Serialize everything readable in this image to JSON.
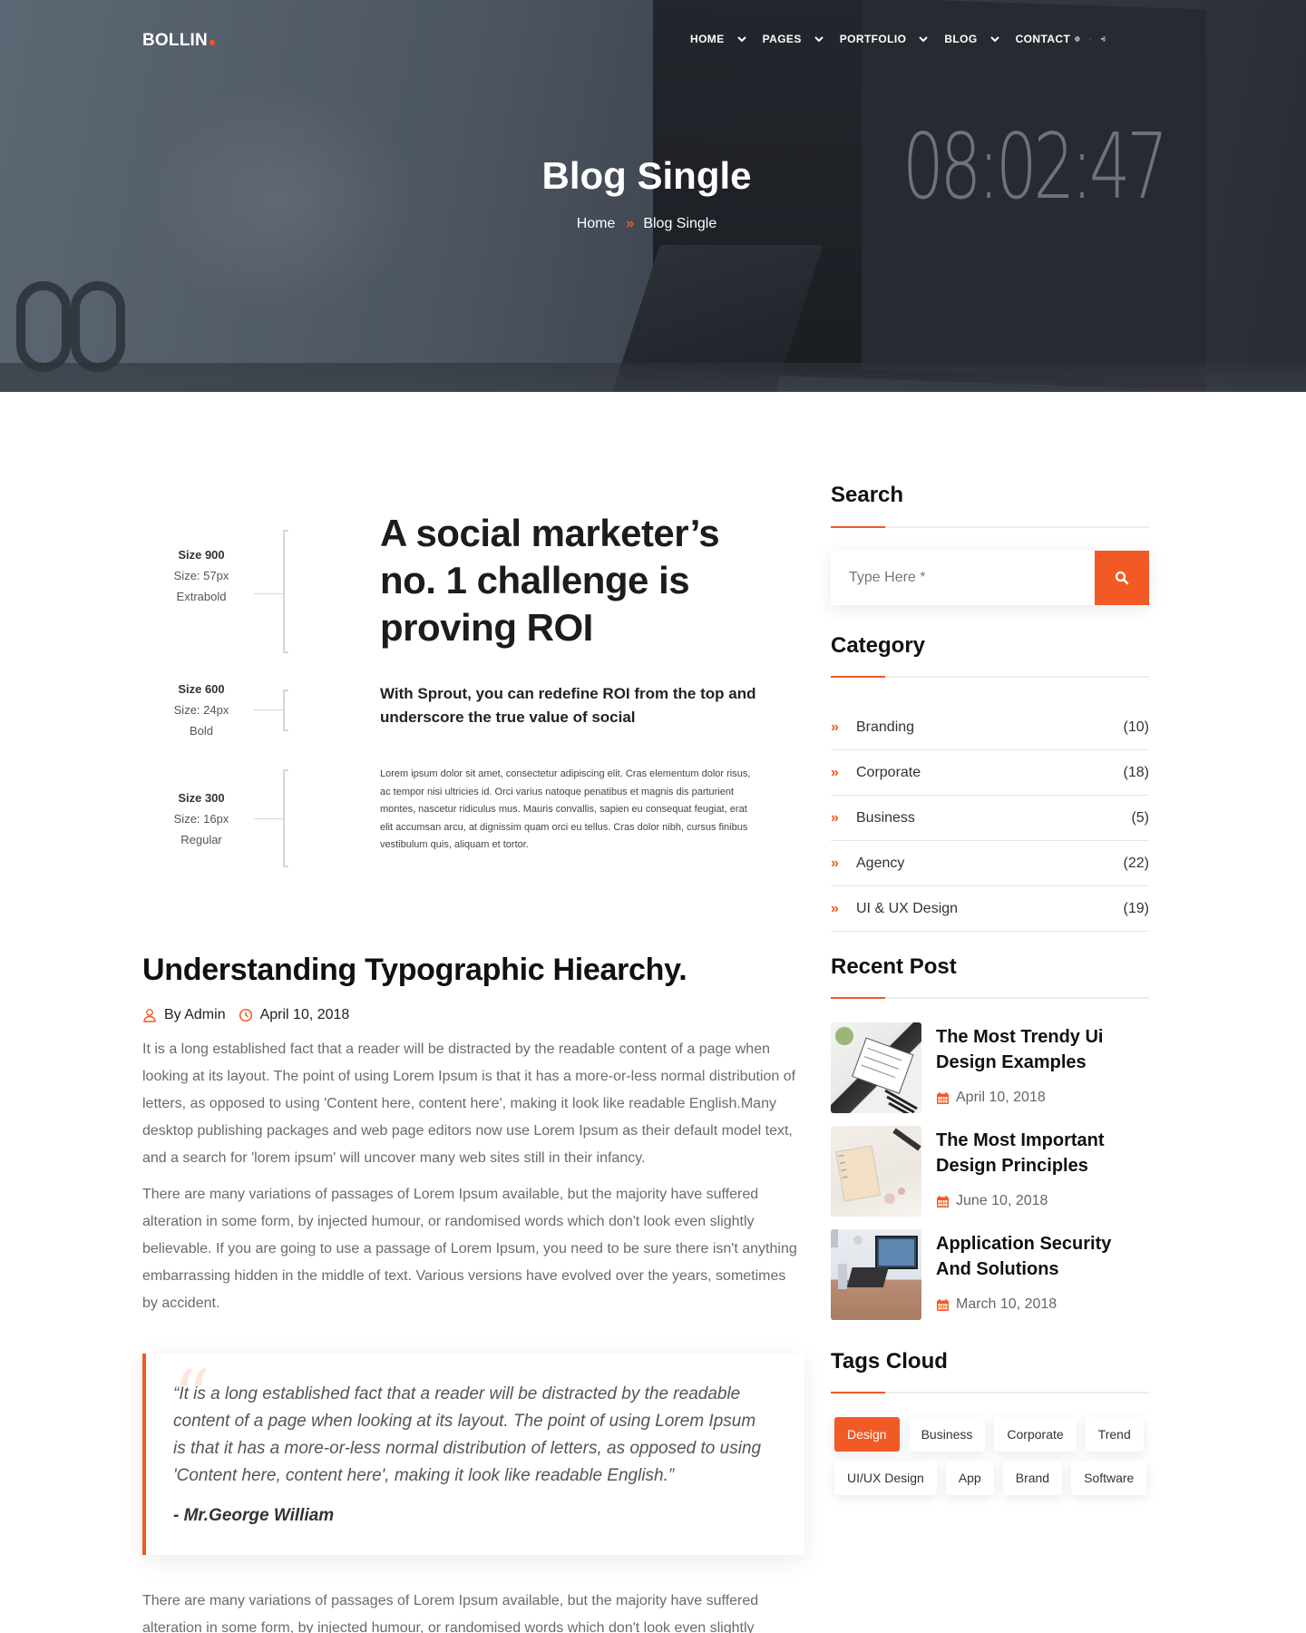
{
  "nav": {
    "logo": "BOLLIN",
    "items": [
      {
        "label": "HOME"
      },
      {
        "label": "PAGES"
      },
      {
        "label": "PORTFOLIO"
      },
      {
        "label": "BLOG"
      },
      {
        "label": "CONTACT"
      }
    ]
  },
  "hero": {
    "title": "Blog Single",
    "clock": "08:02:47",
    "breadcrumb": {
      "home": "Home",
      "current": "Blog Single"
    }
  },
  "figure": {
    "labels": [
      {
        "weight": "Size 900",
        "size": "Size: 57px",
        "style": "Extrabold"
      },
      {
        "weight": "Size 600",
        "size": "Size: 24px",
        "style": "Bold"
      },
      {
        "weight": "Size 300",
        "size": "Size: 16px",
        "style": "Regular"
      }
    ],
    "h1": "A social marketer’s no. 1 challenge is proving ROI",
    "h2": "With Sprout, you can redefine ROI from the top and underscore the true value of social",
    "body": "Lorem ipsum dolor sit amet, consectetur adipiscing elit. Cras elementum dolor risus, ac tempor nisi ultricies id. Orci varius natoque penatibus et magnis dis parturient montes, nascetur ridiculus mus. Mauris convallis, sapien eu consequat feugiat, erat elit accumsan arcu, at dignissim quam orci eu tellus. Cras dolor nibh, cursus finibus vestibulum quis, aliquam et tortor."
  },
  "post": {
    "title": "Understanding Typographic Hiearchy.",
    "author": "By Admin",
    "date": "April 10, 2018",
    "p1": "It is a long established fact that a reader will be distracted by the readable content of a page when looking at its layout. The point of using Lorem Ipsum is that it has a more-or-less normal distribution of letters, as opposed to using 'Content here, content here', making it look like readable English.Many desktop publishing packages and web page editors now use Lorem Ipsum as their default model text, and a search for 'lorem ipsum' will uncover many web sites still in their infancy.",
    "p2": "There are many variations of passages of Lorem Ipsum available, but the majority have suffered alteration in some form, by injected humour, or randomised words which don't look even slightly believable. If you are going to use a passage of Lorem Ipsum, you need to be sure there isn't anything embarrassing hidden in the middle of text. Various versions have evolved over the years, sometimes by accident.",
    "quote": "“It is a long established fact that a reader will be distracted by the readable content of a page when looking at its layout. The point of using Lorem Ipsum is that it has a more-or-less normal distribution of letters, as opposed to using 'Content here, content here', making it look like readable English.”",
    "quote_author": "- Mr.George William",
    "p3": "There are many variations of passages of Lorem Ipsum available, but the majority have suffered alteration in some form, by injected humour, or randomised words which don't look even slightly"
  },
  "sidebar": {
    "search_title": "Search",
    "search_placeholder": "Type Here *",
    "category_title": "Category",
    "categories": [
      {
        "label": "Branding",
        "count": "(10)"
      },
      {
        "label": "Corporate",
        "count": "(18)"
      },
      {
        "label": "Business",
        "count": "(5)"
      },
      {
        "label": "Agency",
        "count": "(22)"
      },
      {
        "label": "UI & UX Design",
        "count": "(19)"
      }
    ],
    "recent_title": "Recent Post",
    "recent": [
      {
        "title": "The Most Trendy Ui Design Examples",
        "date": "April 10, 2018"
      },
      {
        "title": "The Most Important Design Principles",
        "date": "June 10, 2018"
      },
      {
        "title": "Application Security And Solutions",
        "date": "March 10, 2018"
      }
    ],
    "tags_title": "Tags Cloud",
    "tags": [
      "Design",
      "Business",
      "Corporate",
      "Trend",
      "UI/UX Design",
      "App",
      "Brand",
      "Software"
    ]
  },
  "colors": {
    "accent": "#f15a24"
  }
}
